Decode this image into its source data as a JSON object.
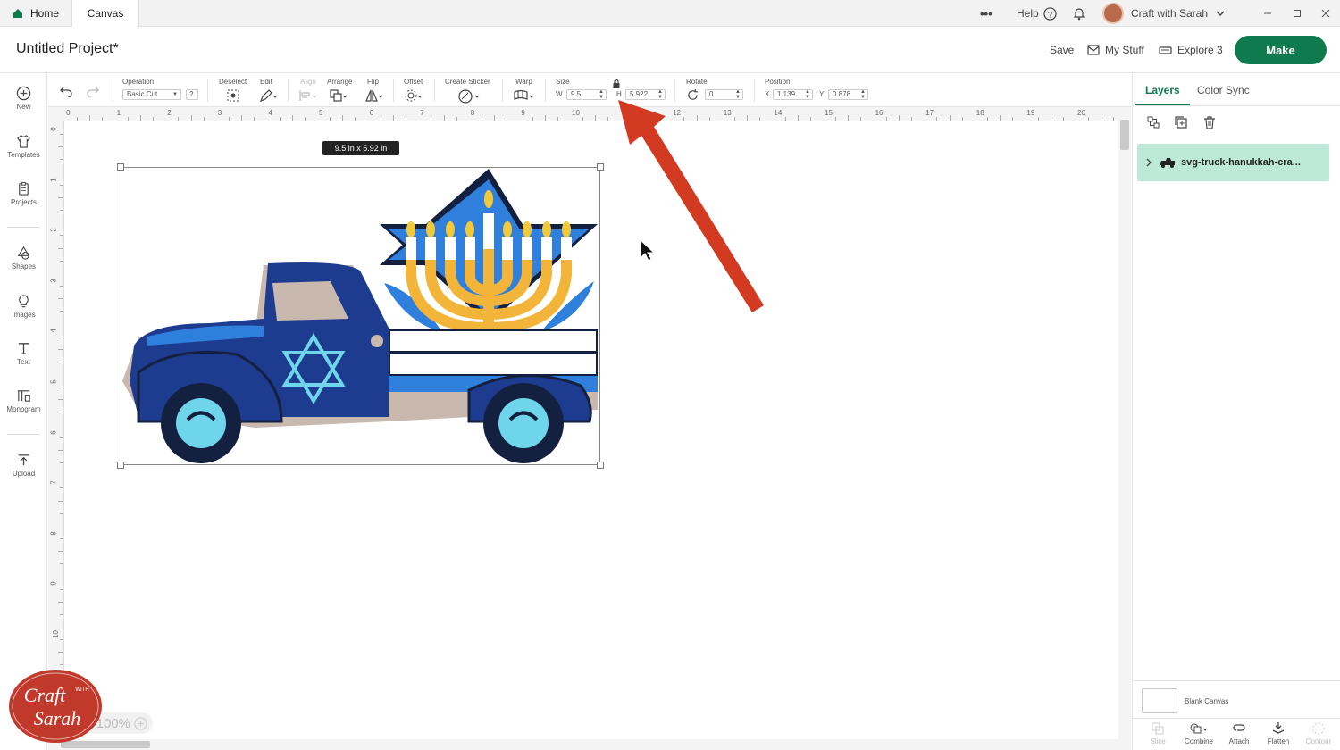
{
  "topbar": {
    "home_label": "Home",
    "canvas_label": "Canvas",
    "more_label": "•••",
    "help_label": "Help",
    "user_name": "Craft with Sarah"
  },
  "header": {
    "project_title": "Untitled Project*",
    "save_label": "Save",
    "mystuff_label": "My Stuff",
    "machine_label": "Explore 3",
    "make_label": "Make"
  },
  "leftbar": {
    "items": [
      {
        "label": "New",
        "icon": "plus-circle-icon"
      },
      {
        "label": "Templates",
        "icon": "shirt-icon"
      },
      {
        "label": "Projects",
        "icon": "clipboard-icon"
      },
      {
        "label": "Shapes",
        "icon": "shapes-icon"
      },
      {
        "label": "Images",
        "icon": "lightbulb-icon"
      },
      {
        "label": "Text",
        "icon": "text-icon"
      },
      {
        "label": "Monogram",
        "icon": "monogram-icon"
      },
      {
        "label": "Upload",
        "icon": "upload-icon"
      }
    ]
  },
  "toolbar": {
    "operation_label": "Operation",
    "operation_value": "Basic Cut",
    "deselect_label": "Deselect",
    "edit_label": "Edit",
    "align_label": "Align",
    "arrange_label": "Arrange",
    "flip_label": "Flip",
    "offset_label": "Offset",
    "sticker_label": "Create Sticker",
    "warp_label": "Warp",
    "size_label": "Size",
    "w_label": "W",
    "w_value": "9.5",
    "h_label": "H",
    "h_value": "5.922",
    "rotate_label": "Rotate",
    "rotate_value": "0",
    "position_label": "Position",
    "x_label": "X",
    "x_value": "1.139",
    "y_label": "Y",
    "y_value": "0.878",
    "help_q": "?"
  },
  "rulers": {
    "horizontal": [
      "0",
      "1",
      "2",
      "3",
      "4",
      "5",
      "6",
      "7",
      "8",
      "9",
      "10",
      "11",
      "12",
      "13",
      "14",
      "15",
      "16",
      "17",
      "18",
      "19",
      "20"
    ],
    "vertical": [
      "0",
      "1",
      "2",
      "3",
      "4",
      "5",
      "6",
      "7",
      "8",
      "9",
      "10"
    ]
  },
  "canvas": {
    "size_tooltip": "9.5  in x 5.92  in",
    "zoom_value": "100%"
  },
  "rightpanel": {
    "tab_layers": "Layers",
    "tab_colorsync": "Color Sync",
    "layer_name": "svg-truck-hanukkah-cra...",
    "blank_canvas_label": "Blank Canvas",
    "bottom_tools": [
      "Slice",
      "Combine",
      "Attach",
      "Flatten",
      "Contour"
    ]
  },
  "logo": {
    "text_line1": "Craft",
    "text_with": "WITH",
    "text_line2": "Sarah"
  },
  "colors": {
    "accent": "#0f7a4e",
    "layer_selected": "#bde9d8",
    "arrow": "#d23a22",
    "truck_dark": "#1d3c8f",
    "truck_light": "#2f7fdc",
    "wheel_hub": "#6fd5ea",
    "menorah_gold": "#f2b53a"
  }
}
